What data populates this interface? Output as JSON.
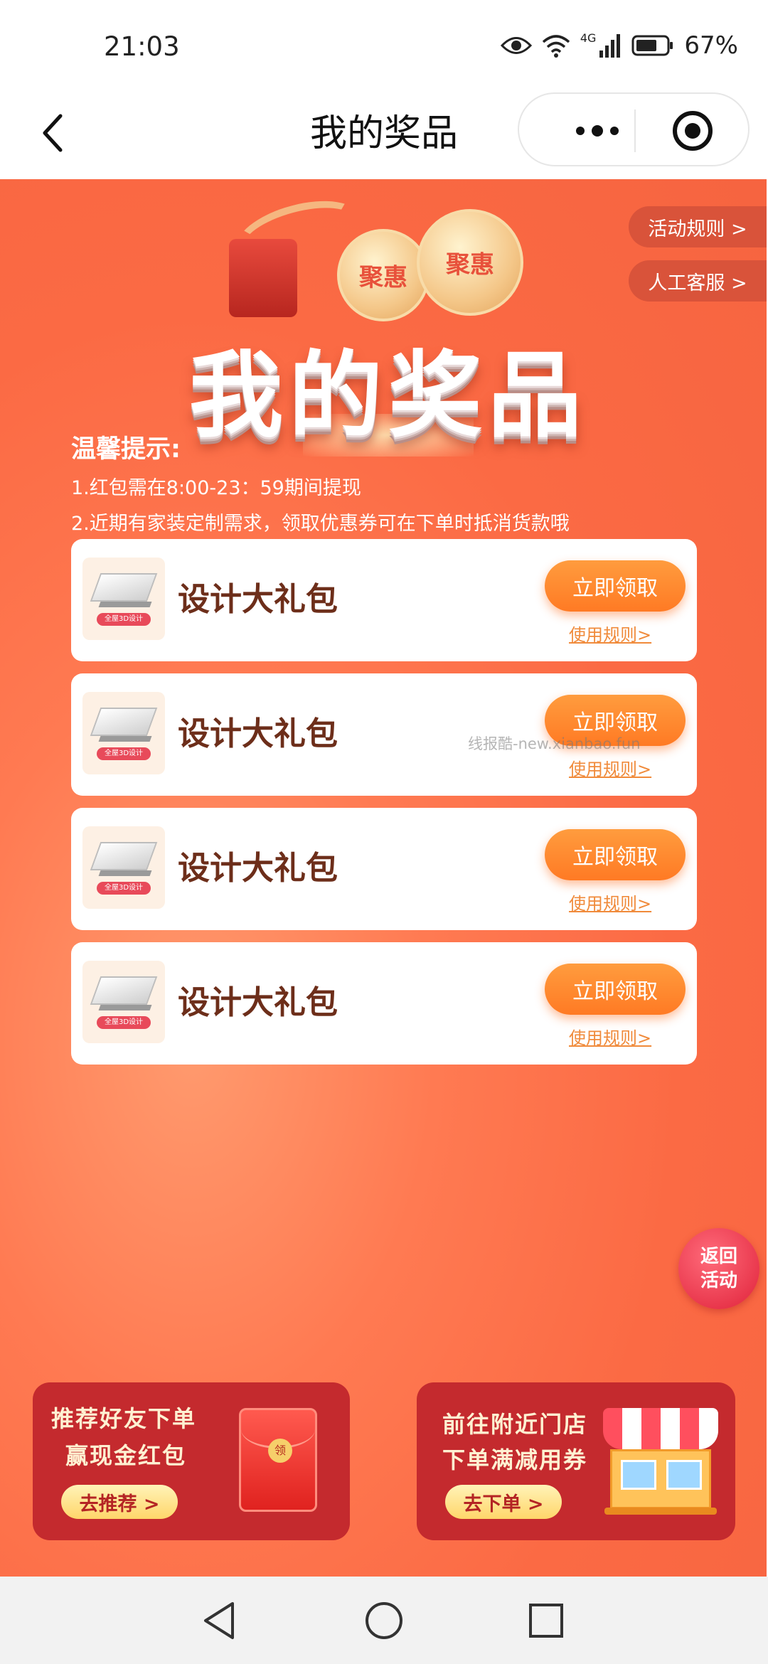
{
  "status_bar": {
    "time": "21:03",
    "network": "4G",
    "battery": "67%",
    "icons": [
      "eye-icon",
      "wifi-icon",
      "signal-icon",
      "battery-icon"
    ]
  },
  "nav": {
    "title": "我的奖品",
    "icons": [
      "back-icon",
      "more-icon",
      "target-icon"
    ]
  },
  "side_tabs": {
    "rules": "活动规则 >",
    "service": "人工客服 >"
  },
  "banner": {
    "title": "我的奖品",
    "coin_text": "聚惠"
  },
  "tips": {
    "title": "温馨提示:",
    "items": [
      "1.红包需在8:00-23：59期间提现",
      "2.近期有家装定制需求，领取优惠券可在下单时抵消货款哦"
    ]
  },
  "prizes": [
    {
      "name": "设计大礼包",
      "thumb_tag": "全屋3D设计",
      "claim_label": "立即领取",
      "rules_label": "使用规则>"
    },
    {
      "name": "设计大礼包",
      "thumb_tag": "全屋3D设计",
      "claim_label": "立即领取",
      "rules_label": "使用规则>"
    },
    {
      "name": "设计大礼包",
      "thumb_tag": "全屋3D设计",
      "claim_label": "立即领取",
      "rules_label": "使用规则>"
    },
    {
      "name": "设计大礼包",
      "thumb_tag": "全屋3D设计",
      "claim_label": "立即领取",
      "rules_label": "使用规则>"
    }
  ],
  "watermark": "线报酷-new.xianbao.fun",
  "return_button": {
    "line1": "返回",
    "line2": "活动"
  },
  "promos": [
    {
      "line1": "推荐好友下单",
      "line2": "赢现金红包",
      "button": "去推荐 >",
      "icon": "red-envelope-icon",
      "envelope_seal": "领"
    },
    {
      "line1": "前往附近门店",
      "line2": "下单满减用券",
      "button": "去下单 >",
      "icon": "store-icon"
    }
  ],
  "system_nav": [
    "back-triangle-icon",
    "home-circle-icon",
    "recents-square-icon"
  ],
  "colors": {
    "main_bg": "#fb6a44",
    "claim_button": "#ff8a2e",
    "prize_text": "#6d2e1a",
    "promo_bg": "#c42a2e",
    "promo_button": "#ffd66a"
  }
}
